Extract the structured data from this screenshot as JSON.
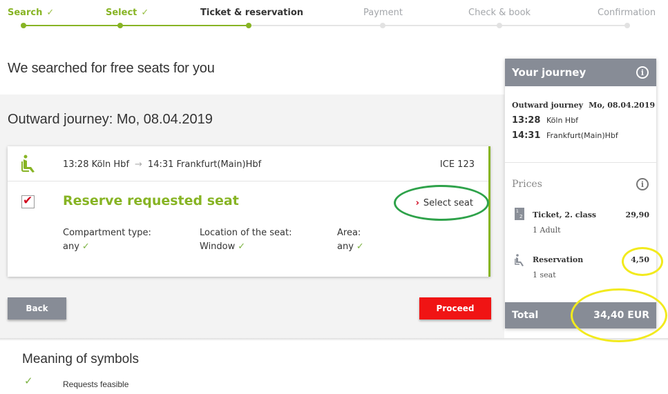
{
  "stepper": {
    "steps": [
      {
        "label": "Search",
        "state": "done",
        "check": "✓"
      },
      {
        "label": "Select",
        "state": "done",
        "check": "✓"
      },
      {
        "label": "Ticket & reservation",
        "state": "active"
      },
      {
        "label": "Payment",
        "state": "todo"
      },
      {
        "label": "Check & book",
        "state": "todo"
      },
      {
        "label": "Confirmation",
        "state": "todo"
      }
    ]
  },
  "intro": "We searched for free seats for you",
  "outward_title": "Outward journey: Mo, 08.04.2019",
  "card": {
    "route_from": "13:28 Köln Hbf",
    "arrow": "→",
    "route_to": "14:31 Frankfurt(Main)Hbf",
    "train": "ICE 123",
    "checkbox_checked": true,
    "checkbox_mark": "✔",
    "reserve_title": "Reserve requested seat",
    "select_seat_chevron": "›",
    "select_seat_label": "Select seat",
    "attributes": [
      {
        "label": "Compartment type:",
        "value": "any",
        "check": "✓"
      },
      {
        "label": "Location of the seat:",
        "value": "Window",
        "check": "✓"
      },
      {
        "label": "Area:",
        "value": "any",
        "check": "✓"
      }
    ]
  },
  "buttons": {
    "back": "Back",
    "proceed": "Proceed"
  },
  "symbols": {
    "title": "Meaning of symbols",
    "items": [
      {
        "icon": "✓",
        "text": "Requests feasible"
      }
    ]
  },
  "sidebar": {
    "title": "Your journey",
    "info_glyph": "i",
    "outward_label": "Outward journey",
    "outward_date": "Mo, 08.04.2019",
    "stops": [
      {
        "time": "13:28",
        "station": "Köln Hbf"
      },
      {
        "time": "14:31",
        "station": "Frankfurt(Main)Hbf"
      }
    ],
    "prices_title": "Prices",
    "prices": [
      {
        "name": "Ticket, 2. class",
        "sub": "1 Adult",
        "value": "29,90"
      },
      {
        "name": "Reservation",
        "sub": "1 seat",
        "value": "4,50"
      }
    ],
    "total_label": "Total",
    "total_value": "34,40 EUR"
  },
  "colors": {
    "accent_green": "#87b424",
    "proceed_red": "#f01414",
    "panel_gray": "#878c96",
    "annotation_green": "#2ea24a",
    "annotation_yellow": "#f2ea1d"
  }
}
